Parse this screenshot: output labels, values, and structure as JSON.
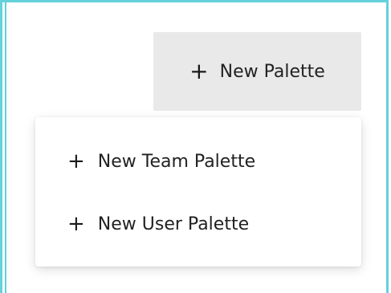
{
  "button": {
    "label": "New Palette",
    "icon": "plus-icon"
  },
  "menu": {
    "items": [
      {
        "label": "New Team Palette",
        "icon": "plus-icon"
      },
      {
        "label": "New User Palette",
        "icon": "plus-icon"
      }
    ]
  },
  "colors": {
    "frame_border": "#64d1dc",
    "button_bg": "#e9e9e9",
    "menu_bg": "#ffffff"
  }
}
